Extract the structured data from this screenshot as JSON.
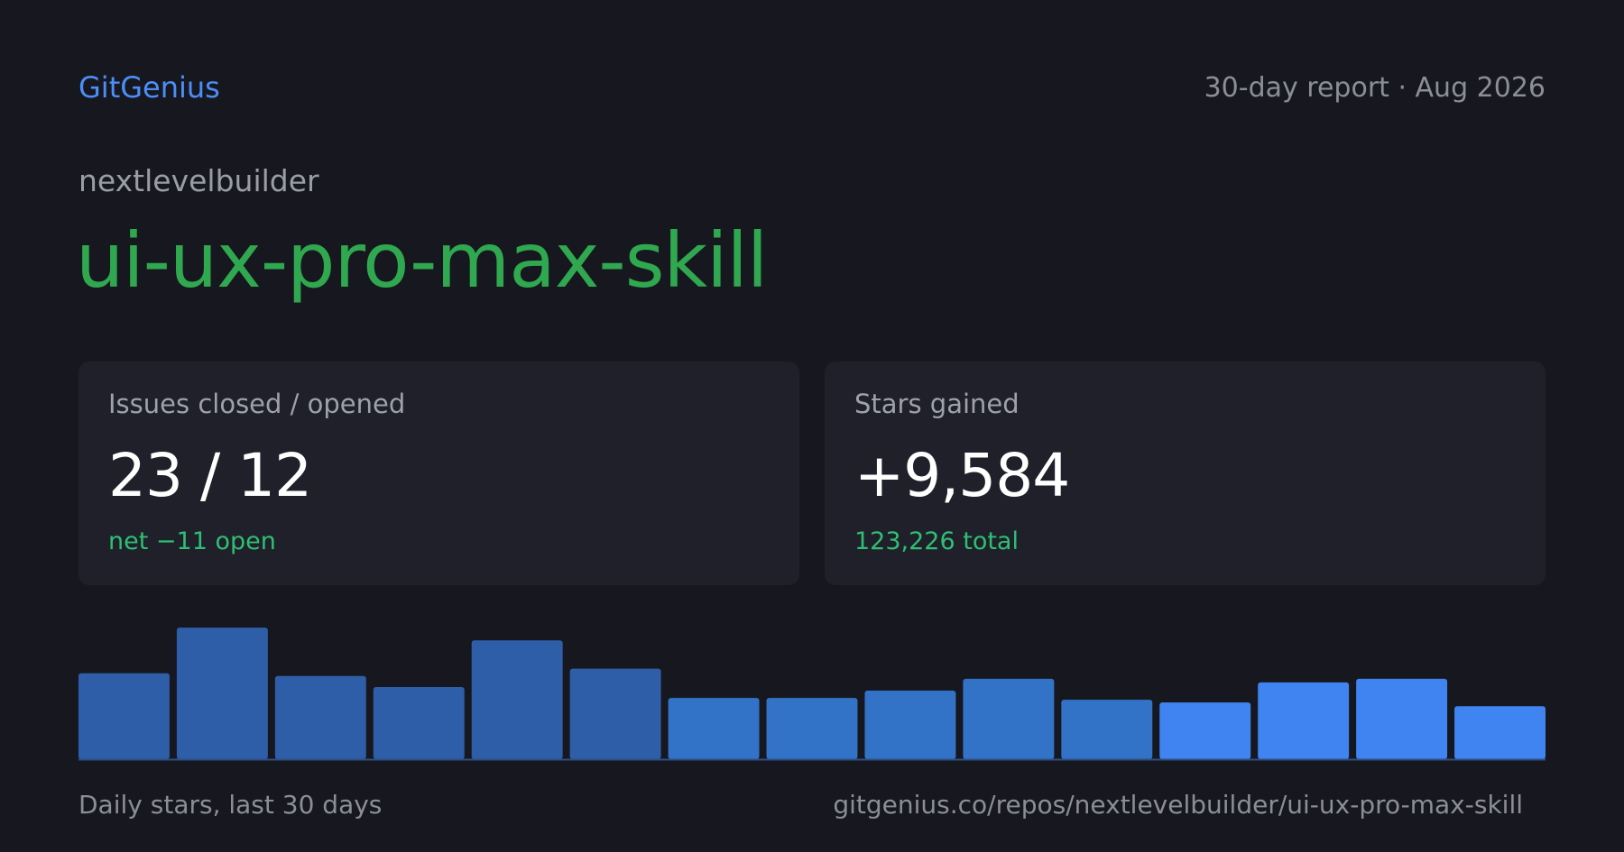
{
  "header": {
    "brand": "GitGenius",
    "report_label": "30-day report · Aug 2026"
  },
  "repo": {
    "owner": "nextlevelbuilder",
    "name": "ui-ux-pro-max-skill"
  },
  "cards": [
    {
      "label": "Issues closed / opened",
      "value": "23 / 12",
      "sub": "net −11 open"
    },
    {
      "label": "Stars gained",
      "value": "+9,584",
      "sub": "123,226 total"
    }
  ],
  "colors": {
    "brand": "#4c8ef7",
    "repo_name": "#2fa84f",
    "positive": "#2fbf74",
    "bar_colors": [
      "#2f5ea8",
      "#3273c8",
      "#3f84f0"
    ]
  },
  "chart_data": {
    "type": "bar",
    "title": "Daily stars, last 30 days",
    "values": [
      94,
      144,
      91,
      79,
      130,
      99,
      67,
      67,
      75,
      88,
      65,
      62,
      84,
      88,
      58
    ],
    "bar_color_index": [
      0,
      0,
      0,
      0,
      0,
      0,
      1,
      1,
      1,
      1,
      1,
      2,
      2,
      2,
      2
    ],
    "ylim": [
      0,
      150
    ],
    "grid": false
  },
  "footer": {
    "caption": "Daily stars, last 30 days",
    "url": "gitgenius.co/repos/nextlevelbuilder/ui-ux-pro-max-skill"
  }
}
